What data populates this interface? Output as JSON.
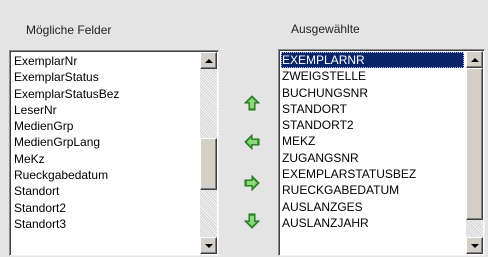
{
  "available": {
    "title": "Mögliche Felder",
    "items": [
      "ExemplarNr",
      "ExemplarStatus",
      "ExemplarStatusBez",
      "LeserNr",
      "MedienGrp",
      "MedienGrpLang",
      "MeKz",
      "Rueckgabedatum",
      "Standort",
      "Standort2",
      "Standort3"
    ]
  },
  "selected": {
    "title": "Ausgewählte",
    "items": [
      "EXEMPLARNR",
      "ZWEIGSTELLE",
      "BUCHUNGSNR",
      "STANDORT",
      "STANDORT2",
      "MEKZ",
      "ZUGANGSNR",
      "EXEMPLARSTATUSBEZ",
      "RUECKGABEDATUM",
      "AUSLANZGES",
      "AUSLANZJAHR"
    ],
    "selected_index": 0
  },
  "move_buttons": [
    "arrow-up-icon",
    "arrow-left-icon",
    "arrow-right-icon",
    "arrow-down-icon"
  ],
  "colors": {
    "arrow_green": "#3f9f35",
    "selection": "#0a246a"
  }
}
